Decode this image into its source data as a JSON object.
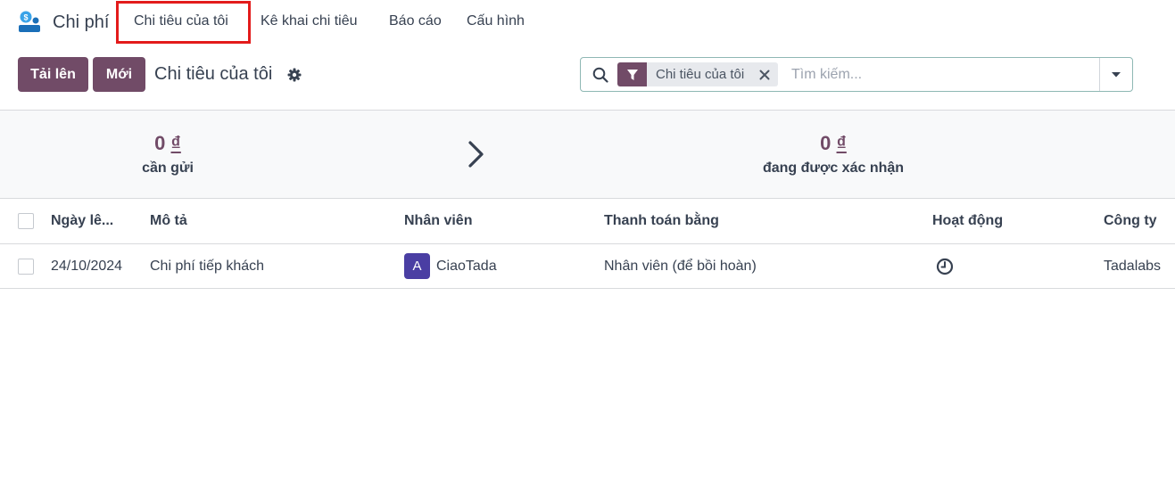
{
  "app": {
    "name": "Chi phí",
    "icon": "expense-app-icon"
  },
  "nav": {
    "items": [
      {
        "label": "Chi tiêu của tôi"
      },
      {
        "label": "Kê khai chi tiêu"
      },
      {
        "label": "Báo cáo"
      },
      {
        "label": "Cấu hình"
      }
    ]
  },
  "toolbar": {
    "upload_label": "Tải lên",
    "new_label": "Mới",
    "title": "Chi tiêu của tôi"
  },
  "search": {
    "facet_label": "Chi tiêu của tôi",
    "placeholder": "Tìm kiếm...",
    "value": ""
  },
  "summary": {
    "to_submit_amount": "0",
    "to_submit_currency": "₫",
    "to_submit_label": "cần gửi",
    "approving_amount": "0",
    "approving_currency": "₫",
    "approving_label": "đang được xác nhận"
  },
  "table": {
    "columns": [
      "Ngày lê...",
      "Mô tả",
      "Nhân viên",
      "Thanh toán bằng",
      "Hoạt động",
      "Công ty"
    ],
    "rows": [
      {
        "date": "24/10/2024",
        "description": "Chi phí tiếp khách",
        "employee_initial": "A",
        "employee": "CiaoTada",
        "paid_by": "Nhân viên (để bồi hoàn)",
        "activity_icon": "clock-icon",
        "company": "Tadalabs"
      }
    ]
  },
  "colors": {
    "primary": "#714b67",
    "highlight": "#e31b1b",
    "avatar": "#4a3ea3"
  }
}
